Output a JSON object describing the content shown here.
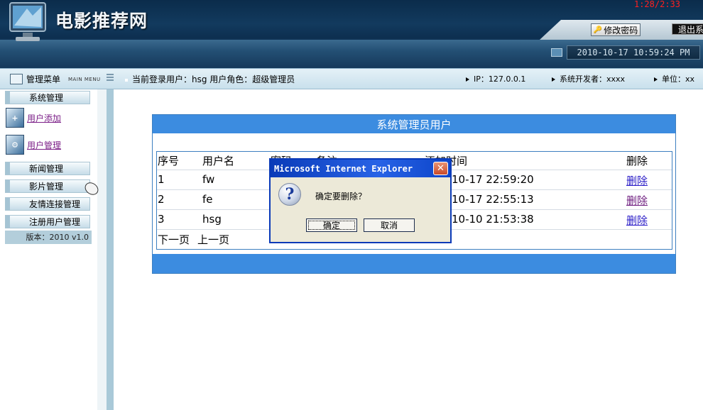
{
  "header": {
    "site_title": "电影推荐网",
    "timer": "1:28/2:33",
    "change_password": "修改密码",
    "logout": "退出系",
    "datetime": "2010-10-17 10:59:24 PM"
  },
  "infobar": {
    "menu_title": "管理菜单",
    "menu_title_en": "MAIN MENU",
    "current_user": "当前登录用户：hsg  用户角色：超级管理员",
    "ip": "IP：127.0.0.1",
    "developer": "系统开发者：xxxx",
    "unit": "单位：xx"
  },
  "sidebar": {
    "system_mgmt": "系统管理",
    "user_add": "用户添加",
    "user_mgmt": "用户管理",
    "news_mgmt": "新闻管理",
    "movie_mgmt": "影片管理",
    "links_mgmt": "友情连接管理",
    "reg_user_mgmt": "注册用户管理",
    "version": "版本：2010 v1.0"
  },
  "panel": {
    "title": "系统管理员用户",
    "columns": [
      "序号",
      "用户名",
      "密码",
      "备注",
      "添加时间",
      "删除"
    ],
    "rows": [
      {
        "no": "1",
        "username": "fw",
        "time": "10-17 22:59:20",
        "delete": "删除"
      },
      {
        "no": "2",
        "username": "fe",
        "time": "10-17 22:55:13",
        "delete": "删除"
      },
      {
        "no": "3",
        "username": "hsg",
        "time": "10-10 21:53:38",
        "delete": "删除"
      }
    ],
    "next_page": "下一页",
    "prev_page": "上一页"
  },
  "dialog": {
    "title": "Microsoft Internet Explorer",
    "message": "确定要删除？",
    "ok": "确定",
    "cancel": "取消"
  }
}
